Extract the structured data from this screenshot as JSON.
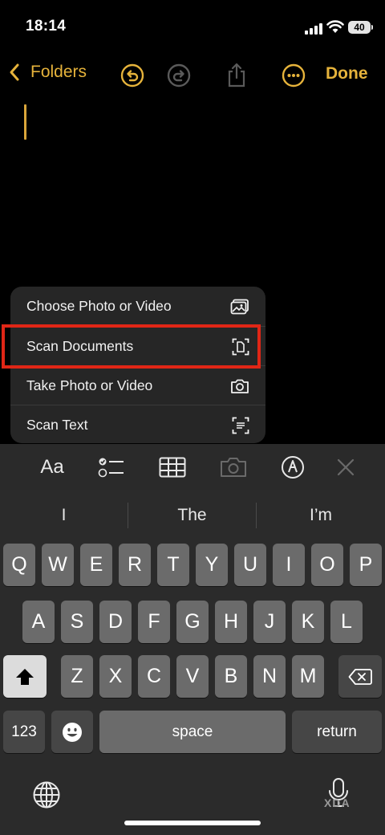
{
  "status_bar": {
    "time": "18:14",
    "battery": "40"
  },
  "nav": {
    "back_label": "Folders",
    "done_label": "Done"
  },
  "menu": {
    "items": [
      {
        "label": "Choose Photo or Video",
        "icon": "photo-icon"
      },
      {
        "label": "Scan Documents",
        "icon": "doc-scan-icon",
        "highlighted": true
      },
      {
        "label": "Take Photo or Video",
        "icon": "camera-icon"
      },
      {
        "label": "Scan Text",
        "icon": "text-scan-icon"
      }
    ],
    "highlight_color": "#e02616"
  },
  "toolbar": {
    "format_label": "Aa"
  },
  "keyboard": {
    "suggestions": [
      "I",
      "The",
      "I’m"
    ],
    "row1": [
      "Q",
      "W",
      "E",
      "R",
      "T",
      "Y",
      "U",
      "I",
      "O",
      "P"
    ],
    "row2": [
      "A",
      "S",
      "D",
      "F",
      "G",
      "H",
      "J",
      "K",
      "L"
    ],
    "row3": [
      "Z",
      "X",
      "C",
      "V",
      "B",
      "N",
      "M"
    ],
    "numbers_label": "123",
    "space_label": "space",
    "return_label": "return"
  },
  "watermark": "XDA",
  "colors": {
    "accent": "#e6b33b",
    "background": "#000000"
  }
}
